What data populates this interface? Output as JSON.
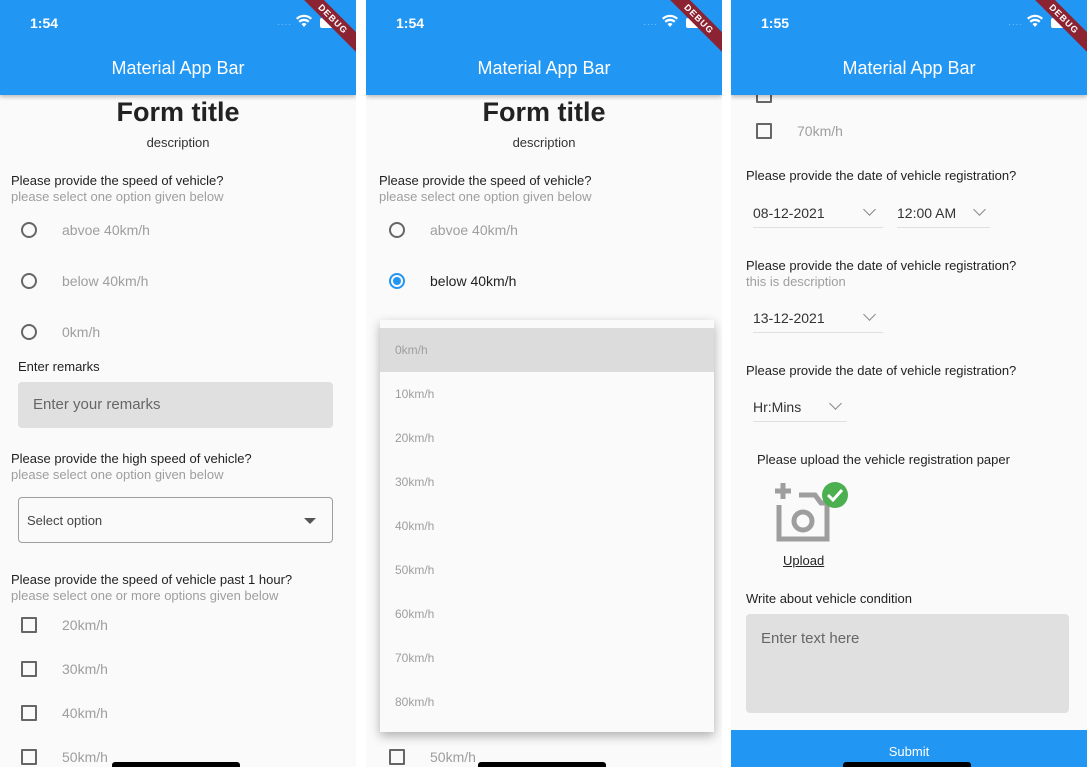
{
  "screens": [
    {
      "status": {
        "time": "1:54",
        "signal": "····",
        "debug_label": "DEBUG"
      },
      "appbar_title": "Material App Bar",
      "form_title": "Form title",
      "form_description": "description",
      "speed_question": {
        "label": "Please provide the speed of vehicle?",
        "hint": "please select one option given below",
        "options": [
          {
            "label": "abvoe 40km/h",
            "selected": false
          },
          {
            "label": "below 40km/h",
            "selected": false
          },
          {
            "label": "0km/h",
            "selected": false
          }
        ]
      },
      "remarks": {
        "label": "Enter remarks",
        "placeholder": "Enter your remarks"
      },
      "high_speed_question": {
        "label": "Please provide the high speed of vehicle?",
        "hint": "please select one option given below",
        "select_placeholder": "Select option"
      },
      "past_hour_question": {
        "label": "Please provide the speed of vehicle past 1 hour?",
        "hint": "please select one or more options given below",
        "options": [
          "20km/h",
          "30km/h",
          "40km/h",
          "50km/h"
        ]
      }
    },
    {
      "status": {
        "time": "1:54",
        "signal": "····",
        "debug_label": "DEBUG"
      },
      "appbar_title": "Material App Bar",
      "form_title": "Form title",
      "form_description": "description",
      "speed_question": {
        "label": "Please provide the speed of vehicle?",
        "hint": "please select one option given below",
        "options": [
          {
            "label": "abvoe 40km/h",
            "selected": false
          },
          {
            "label": "below 40km/h",
            "selected": true
          }
        ]
      },
      "dropdown_menu": {
        "highlighted": "0km/h",
        "items": [
          "0km/h",
          "10km/h",
          "20km/h",
          "30km/h",
          "40km/h",
          "50km/h",
          "60km/h",
          "70km/h",
          "80km/h"
        ]
      },
      "trailing_checkbox": "50km/h"
    },
    {
      "status": {
        "time": "1:55",
        "signal": "····",
        "debug_label": "DEBUG"
      },
      "appbar_title": "Material App Bar",
      "checkbox_option": "70km/h",
      "date_time_question": {
        "label": "Please provide the date of vehicle registration?",
        "date": "08-12-2021",
        "time": "12:00 AM"
      },
      "date_question": {
        "label": "Please provide the date of vehicle registration?",
        "hint": "this is description",
        "date": "13-12-2021"
      },
      "time_question": {
        "label": "Please provide the date of vehicle registration?",
        "time_placeholder": "Hr:Mins"
      },
      "upload": {
        "label": "Please upload the vehicle registration paper",
        "link": "Upload",
        "status_color": "#4caf50"
      },
      "condition": {
        "label": "Write about vehicle condition",
        "placeholder": "Enter text here"
      },
      "submit_label": "Submit"
    }
  ],
  "colors": {
    "primary": "#2196f3",
    "debug_ribbon": "#8b2332",
    "success": "#4caf50"
  }
}
